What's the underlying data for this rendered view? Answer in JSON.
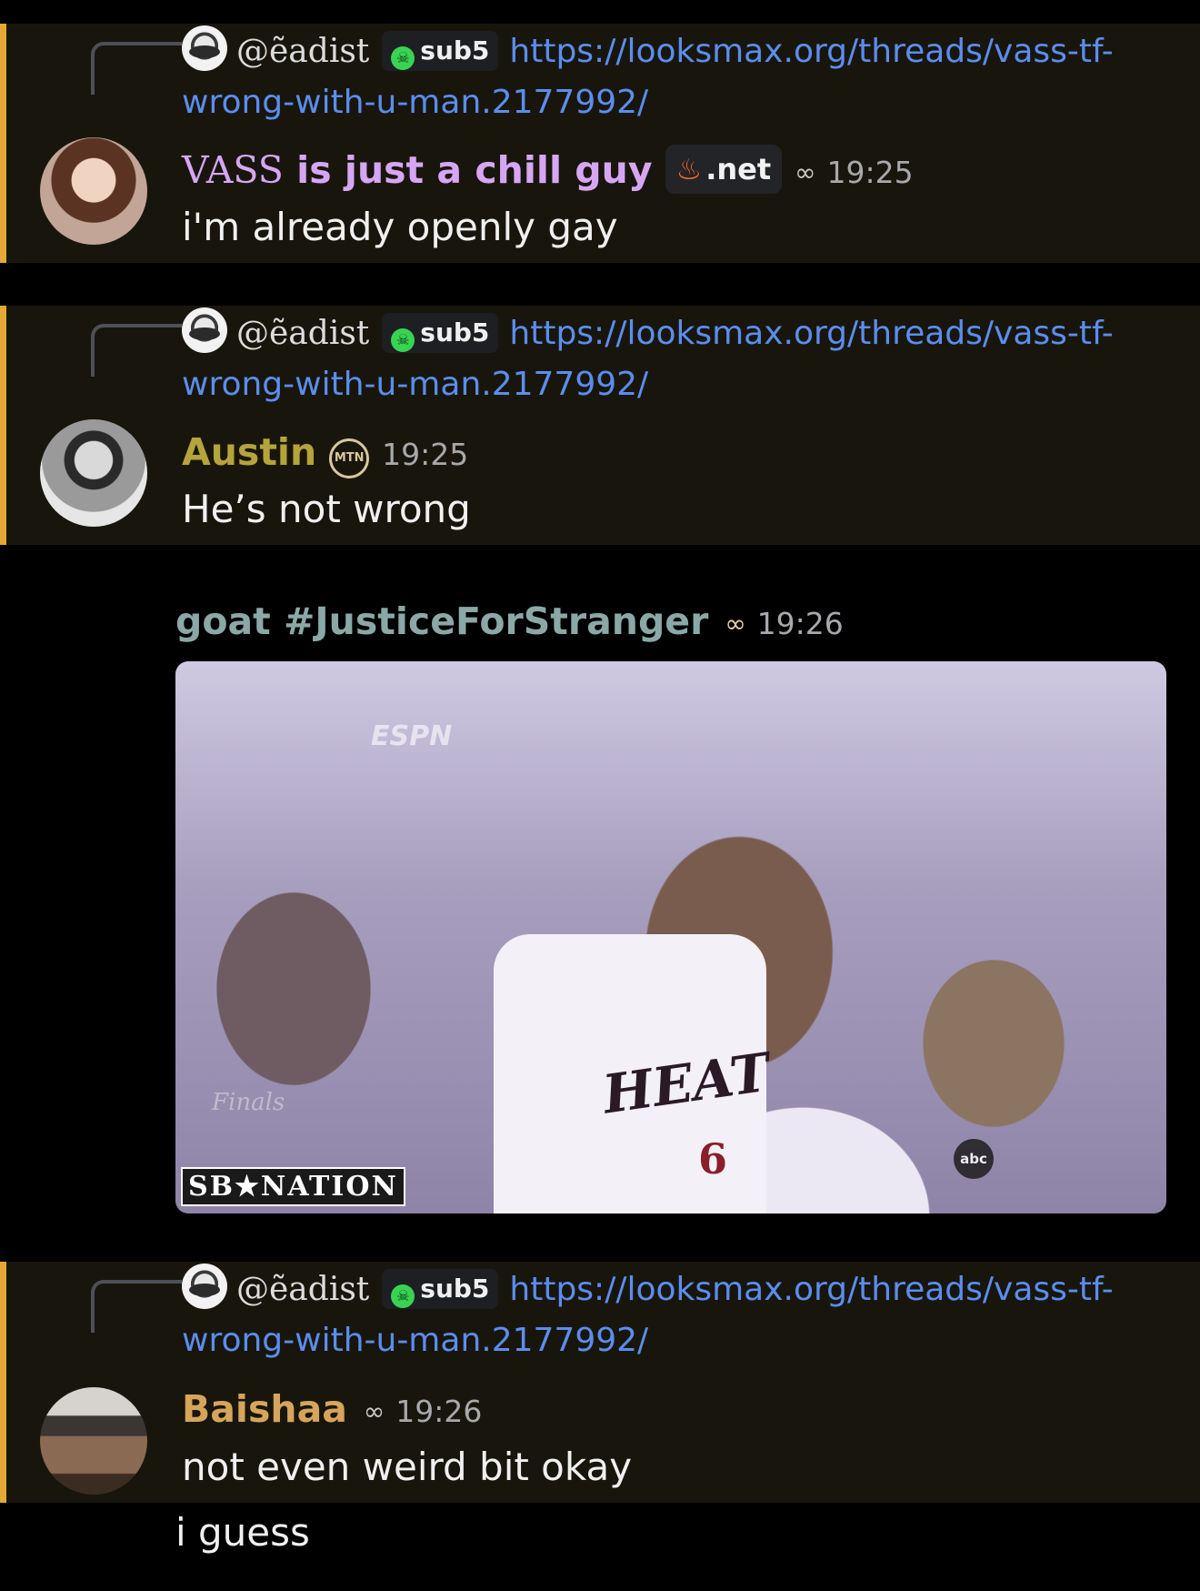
{
  "reply_ref": {
    "handle": "@ẽadist",
    "badge": "sub5",
    "link": "https://looksmax.org/threads/vass-tf-wrong-with-u-man.2177992/"
  },
  "messages": [
    {
      "name": "VASS",
      "name_rest": " is just a chill guy",
      "name_color": "#d6a6f5",
      "badge": ".net",
      "role_icon": "infinity-icon",
      "time": "19:25",
      "text": "i'm already openly gay"
    },
    {
      "name": "Austin",
      "name_color": "#b5a33c",
      "badge": "MTN",
      "time": "19:25",
      "text": "He’s not wrong"
    },
    {
      "name": "goat #JusticeForStranger",
      "name_color": "#8aa8a6",
      "role_icon": "infinity-icon",
      "time": "19:26",
      "gif_overlays": {
        "network": "ESPN",
        "jersey": "HEAT",
        "number": "6",
        "watermark": "SB★NATION",
        "abc": "abc",
        "finals": "Finals"
      }
    },
    {
      "name": "Baishaa",
      "name_color": "#d6a55b",
      "role_icon": "infinity-icon",
      "time": "19:26",
      "text": "not even weird bit okay",
      "text2": "i guess"
    }
  ],
  "colors": {
    "mention_bar": "#e3a934",
    "mention_bg": "#18160c",
    "link": "#5b8def"
  }
}
